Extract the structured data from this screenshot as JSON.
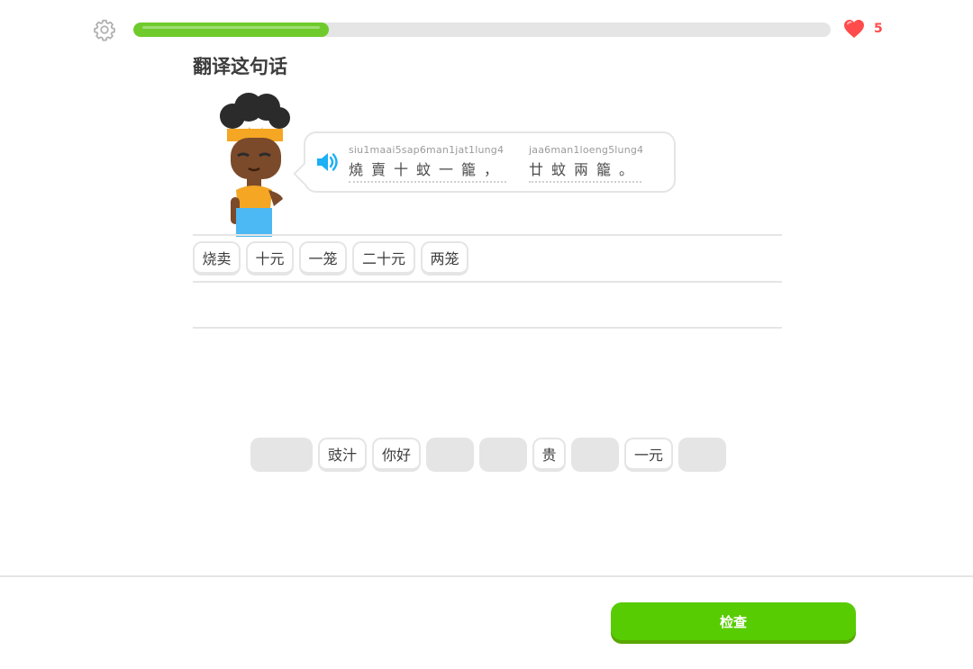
{
  "header": {
    "settings_icon": "gear-icon",
    "progress_fraction": 0.28,
    "hearts_icon": "heart-icon",
    "hearts_count": "5"
  },
  "prompt": {
    "title": "翻译这句话"
  },
  "bubble": {
    "speaker_icon": "speaker-icon",
    "phrase1_roman": "siu1maai5sap6man1jat1lung4",
    "phrase1_hanzi": "燒賣十蚊一籠，",
    "phrase2_roman": "jaa6man1loeng5lung4",
    "phrase2_hanzi": "廿蚊兩籠。"
  },
  "answer": {
    "tiles": [
      "烧卖",
      "十元",
      "一笼",
      "二十元",
      "两笼"
    ]
  },
  "word_bank": {
    "tiles": [
      "豉汁",
      "你好",
      "贵",
      "一元"
    ]
  },
  "footer": {
    "check_label": "检查"
  },
  "colors": {
    "progress": "#6fcb2c",
    "hearts": "#ff4b4b",
    "check_button": "#58cc02"
  }
}
